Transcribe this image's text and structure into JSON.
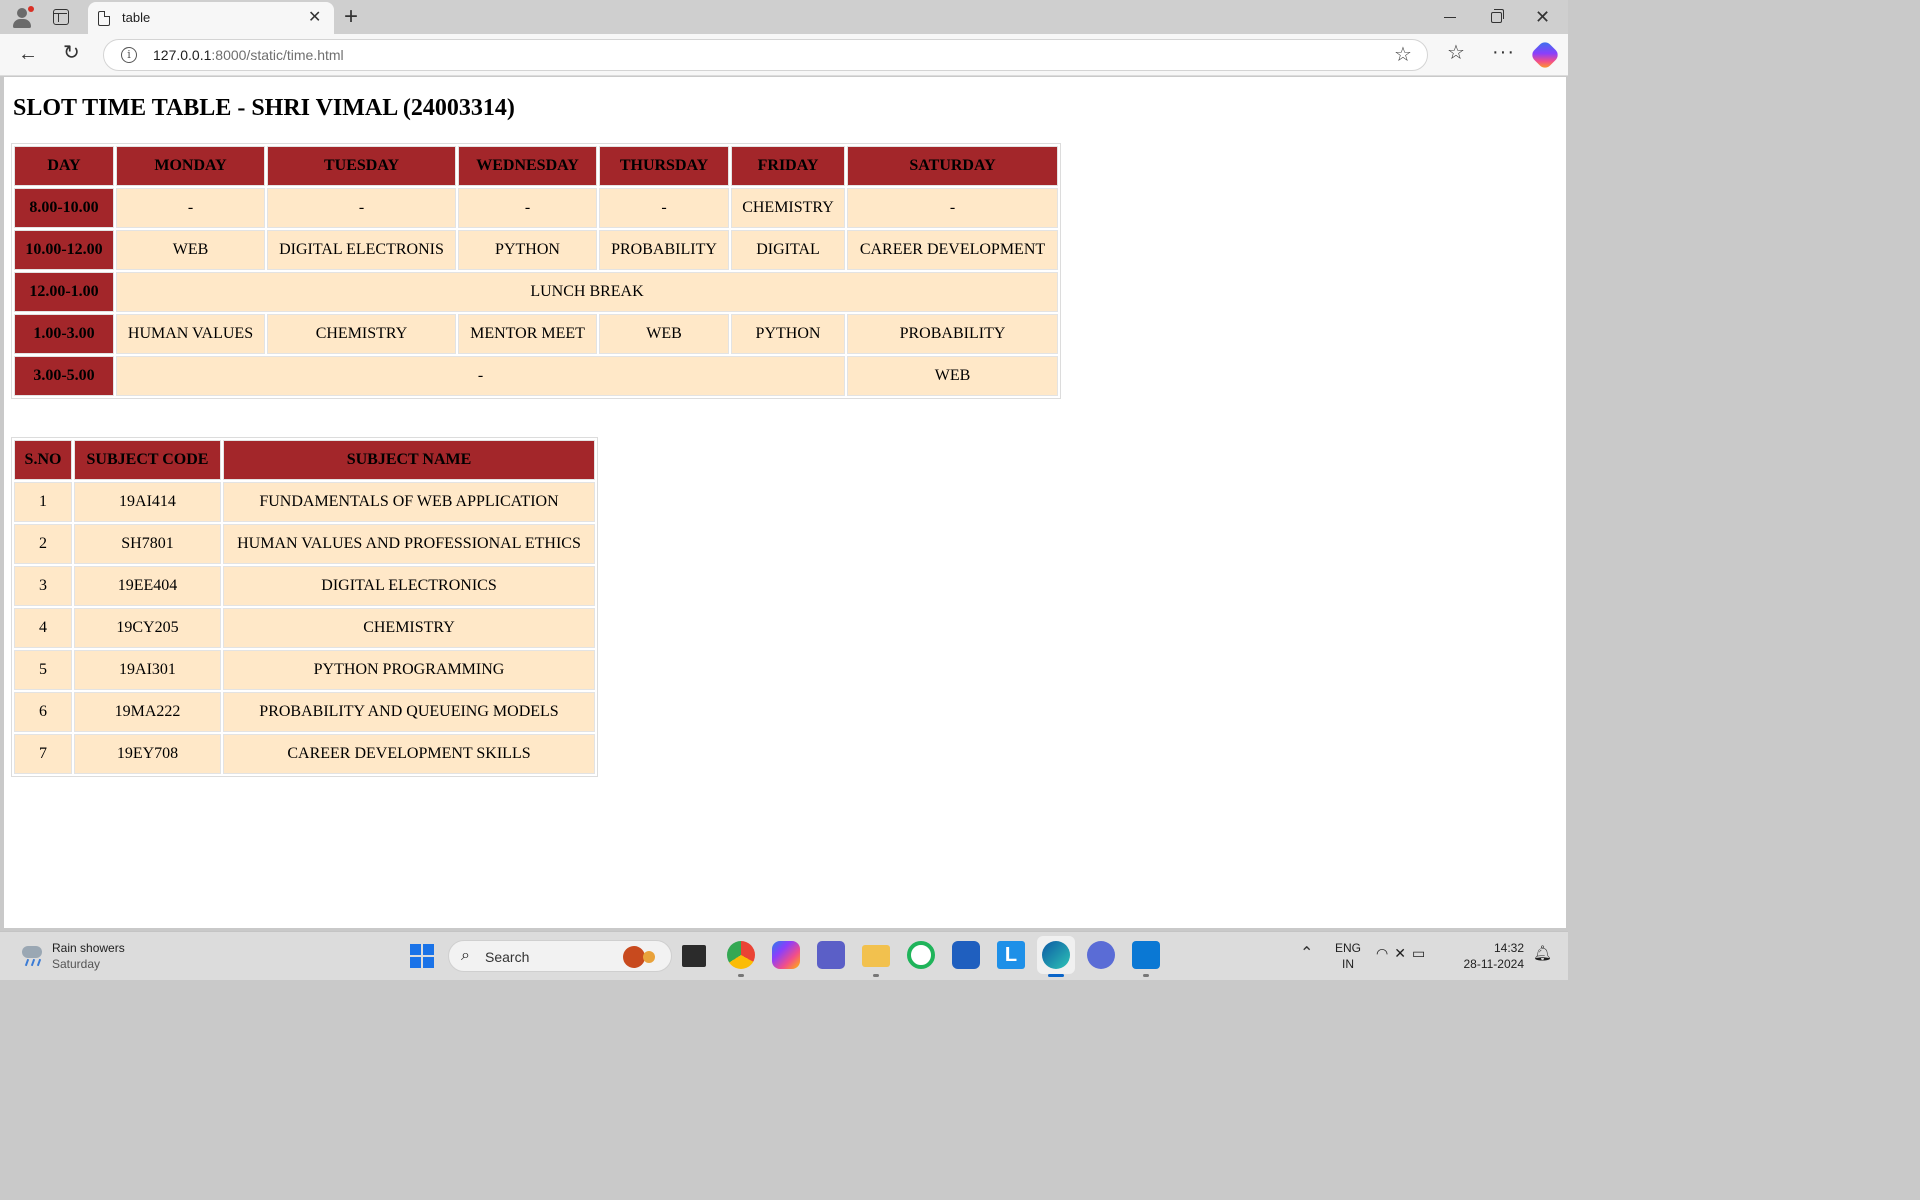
{
  "browser": {
    "tab_title": "table",
    "url_host": "127.0.0.1",
    "url_path": ":8000/static/time.html"
  },
  "page": {
    "title": "SLOT TIME TABLE - SHRI VIMAL (24003314)"
  },
  "timetable": {
    "headers": [
      "DAY",
      "MONDAY",
      "TUESDAY",
      "WEDNESDAY",
      "THURSDAY",
      "FRIDAY",
      "SATURDAY"
    ],
    "rows": [
      {
        "slot": "8.00-10.00",
        "cells": [
          "-",
          "-",
          "-",
          "-",
          "CHEMISTRY",
          "-"
        ]
      },
      {
        "slot": "10.00-12.00",
        "cells": [
          "WEB",
          "DIGITAL ELECTRONIS",
          "PYTHON",
          "PROBABILITY",
          "DIGITAL",
          "CAREER DEVELOPMENT"
        ]
      },
      {
        "slot": "12.00-1.00",
        "lunch": "LUNCH BREAK"
      },
      {
        "slot": "1.00-3.00",
        "cells": [
          "HUMAN VALUES",
          "CHEMISTRY",
          "MENTOR MEET",
          "WEB",
          "PYTHON",
          "PROBABILITY"
        ]
      },
      {
        "slot": "3.00-5.00",
        "merged": "-",
        "last": "WEB"
      }
    ]
  },
  "subjects": {
    "headers": [
      "S.NO",
      "SUBJECT CODE",
      "SUBJECT NAME"
    ],
    "rows": [
      [
        "1",
        "19AI414",
        "FUNDAMENTALS OF WEB APPLICATION"
      ],
      [
        "2",
        "SH7801",
        "HUMAN VALUES AND PROFESSIONAL ETHICS"
      ],
      [
        "3",
        "19EE404",
        "DIGITAL ELECTRONICS"
      ],
      [
        "4",
        "19CY205",
        "CHEMISTRY"
      ],
      [
        "5",
        "19AI301",
        "PYTHON PROGRAMMING"
      ],
      [
        "6",
        "19MA222",
        "PROBABILITY AND QUEUEING MODELS"
      ],
      [
        "7",
        "19EY708",
        "CAREER DEVELOPMENT SKILLS"
      ]
    ]
  },
  "taskbar": {
    "weather_title": "Rain showers",
    "weather_sub": "Saturday",
    "search_label": "Search",
    "lang_line1": "ENG",
    "lang_line2": "IN",
    "time": "14:32",
    "date": "28-11-2024"
  },
  "colors": {
    "header_bg": "#a3262a",
    "cell_bg": "#ffe8c8"
  }
}
